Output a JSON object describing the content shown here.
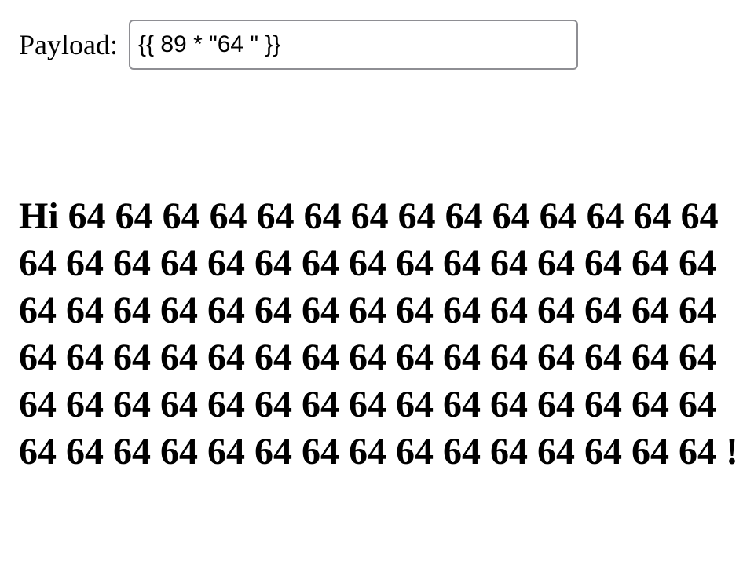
{
  "form": {
    "label": "Payload:",
    "input_value": "{{ 89 * \"64 \" }}"
  },
  "output": {
    "text": "Hi 64 64 64 64 64 64 64 64 64 64 64 64 64 64 64 64 64 64 64 64 64 64 64 64 64 64 64 64 64 64 64 64 64 64 64 64 64 64 64 64 64 64 64 64 64 64 64 64 64 64 64 64 64 64 64 64 64 64 64 64 64 64 64 64 64 64 64 64 64 64 64 64 64 64 64 64 64 64 64 64 64 64 64 64 64 64 64 64 64 !"
  }
}
